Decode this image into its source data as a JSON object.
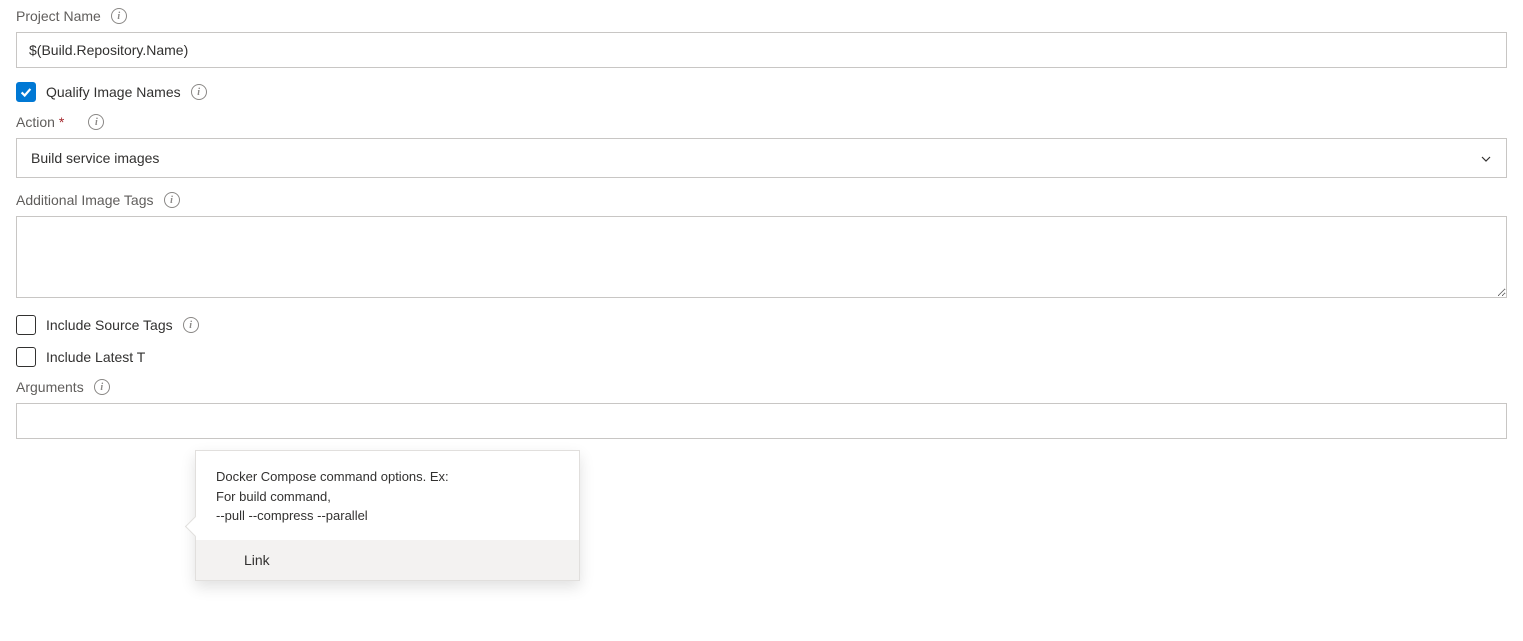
{
  "projectName": {
    "label": "Project Name",
    "value": "$(Build.Repository.Name)"
  },
  "qualifyImageNames": {
    "label": "Qualify Image Names",
    "checked": true
  },
  "action": {
    "label": "Action",
    "value": "Build service images"
  },
  "additionalImageTags": {
    "label": "Additional Image Tags",
    "value": ""
  },
  "includeSourceTags": {
    "label": "Include Source Tags",
    "checked": false
  },
  "includeLatestTag": {
    "label": "Include Latest T",
    "checked": false
  },
  "arguments": {
    "label": "Arguments",
    "value": ""
  },
  "tooltip": {
    "body": "Docker Compose command options. Ex:\nFor build command,\n--pull --compress --parallel",
    "link": "Link"
  }
}
